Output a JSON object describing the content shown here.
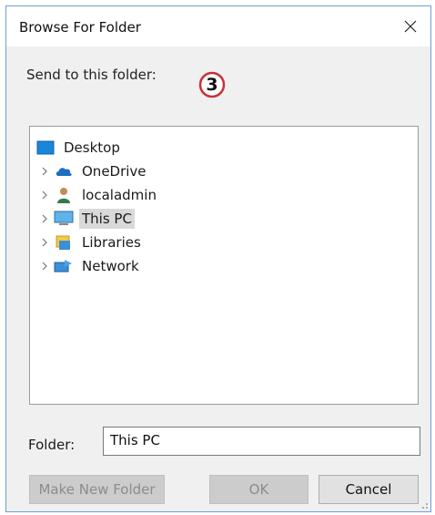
{
  "window": {
    "title": "Browse For Folder"
  },
  "instruction": "Send to this folder:",
  "step_badge": "3",
  "tree": {
    "items": [
      {
        "label": "Desktop",
        "icon": "desktop-icon",
        "expandable": false,
        "selected": false
      },
      {
        "label": "OneDrive",
        "icon": "onedrive-cloud-icon",
        "expandable": true,
        "selected": false
      },
      {
        "label": "localadmin",
        "icon": "user-icon",
        "expandable": true,
        "selected": false
      },
      {
        "label": "This PC",
        "icon": "computer-icon",
        "expandable": true,
        "selected": true
      },
      {
        "label": "Libraries",
        "icon": "libraries-icon",
        "expandable": true,
        "selected": false
      },
      {
        "label": "Network",
        "icon": "network-icon",
        "expandable": true,
        "selected": false
      }
    ]
  },
  "folder": {
    "label": "Folder:",
    "value": "This PC"
  },
  "buttons": {
    "make_new_folder": "Make New Folder",
    "ok": "OK",
    "cancel": "Cancel"
  },
  "colors": {
    "accent_border": "#6b9ed6",
    "badge_ring": "#c8323a",
    "selection": "#d9d9d9"
  }
}
